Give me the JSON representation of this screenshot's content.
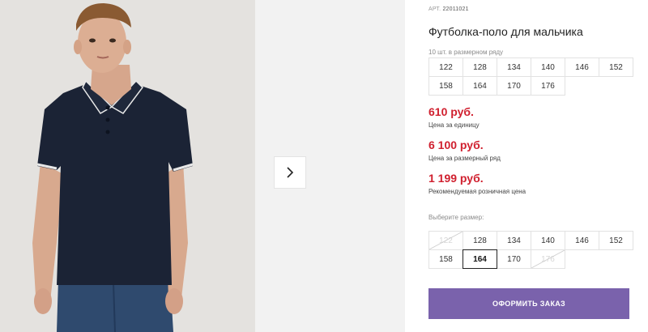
{
  "product": {
    "art_prefix": "АРТ.",
    "art_code": "22011021",
    "title": "Футболка-поло для мальчика",
    "pack_note": "10 шт. в размерном ряду",
    "pack_sizes": [
      "122",
      "128",
      "134",
      "140",
      "146",
      "152",
      "158",
      "164",
      "170",
      "176"
    ]
  },
  "prices": [
    {
      "value": "610 руб.",
      "label": "Цена за единицу"
    },
    {
      "value": "6 100 руб.",
      "label": "Цена за размерный ряд"
    },
    {
      "value": "1 199 руб.",
      "label": "Рекомендуемая розничная цена"
    }
  ],
  "size_picker": {
    "label": "Выберите размер:",
    "sizes": [
      {
        "size": "122",
        "state": "disabled"
      },
      {
        "size": "128",
        "state": "available"
      },
      {
        "size": "134",
        "state": "available"
      },
      {
        "size": "140",
        "state": "available"
      },
      {
        "size": "146",
        "state": "available"
      },
      {
        "size": "152",
        "state": "available"
      },
      {
        "size": "158",
        "state": "available"
      },
      {
        "size": "164",
        "state": "selected"
      },
      {
        "size": "170",
        "state": "available"
      },
      {
        "size": "176",
        "state": "disabled"
      }
    ]
  },
  "gallery": {
    "next_icon": "chevron-right-icon",
    "photo_alt": "boy-in-navy-polo"
  },
  "order_button": {
    "label": "ОФОРМИТЬ ЗАКАЗ"
  },
  "colors": {
    "accent": "#7a62ac",
    "price": "#d0202f",
    "polo": "#1b2335"
  }
}
